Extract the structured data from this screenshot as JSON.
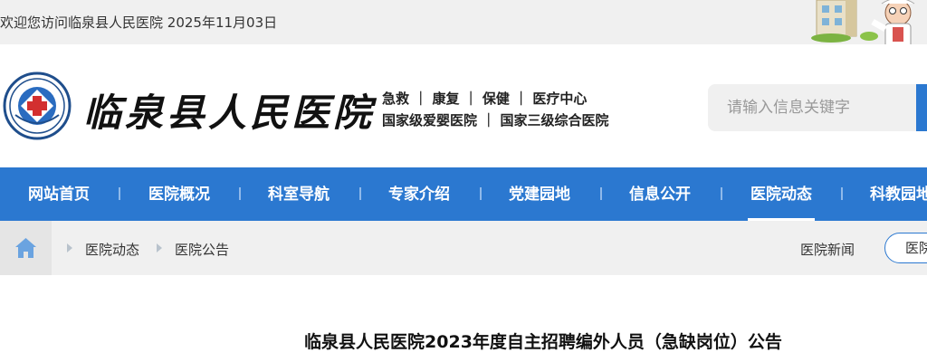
{
  "topbar": {
    "welcome": "欢迎您访问临泉县人民医院 2025年11月03日"
  },
  "header": {
    "logo_name": "hospital-logo",
    "site_name": "临泉县人民医院",
    "slogan_line1": "急救 ｜ 康复 ｜ 保健 ｜ 医疗中心",
    "slogan_line2": "国家级爱婴医院 ｜ 国家三级综合医院"
  },
  "search": {
    "placeholder": "请输入信息关键字"
  },
  "nav": {
    "items": [
      {
        "label": "网站首页"
      },
      {
        "label": "医院概况"
      },
      {
        "label": "科室导航"
      },
      {
        "label": "专家介绍"
      },
      {
        "label": "党建园地"
      },
      {
        "label": "信息公开"
      },
      {
        "label": "医院动态",
        "active": true
      },
      {
        "label": "科教园地"
      }
    ]
  },
  "breadcrumb": {
    "home_icon": "home-icon",
    "items": [
      "医院动态",
      "医院公告"
    ]
  },
  "subnav": {
    "news": "医院新闻",
    "notice": "医院公告"
  },
  "article": {
    "title": "临泉县人民医院2023年度自主招聘编外人员（急缺岗位）公告"
  },
  "colors": {
    "primary": "#2b78d0",
    "topbar_bg": "#f0f0f0",
    "crumb_bg": "#f0f0f0"
  }
}
